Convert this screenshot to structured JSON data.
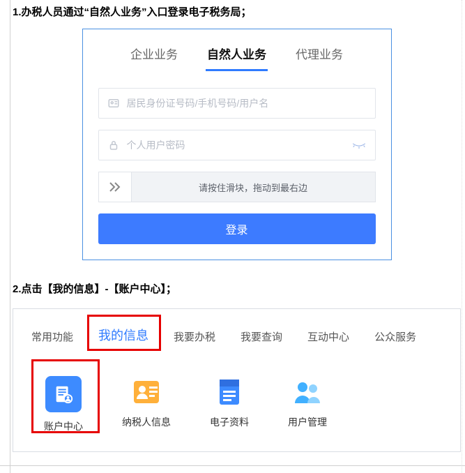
{
  "step1": "1.办税人员通过“自然人业务”入口登录电子税务局；",
  "login": {
    "tabs": [
      "企业业务",
      "自然人业务",
      "代理业务"
    ],
    "active_tab": 1,
    "id_placeholder": "居民身份证号码/手机号码/用户名",
    "pw_placeholder": "个人用户密码",
    "slider_text": "请按住滑块，拖动到最右边",
    "login_label": "登录"
  },
  "step2": "2.点击【我的信息】-【账户中心】；",
  "nav": {
    "tabs": [
      "常用功能",
      "我的信息",
      "我要办税",
      "我要查询",
      "互动中心",
      "公众服务"
    ],
    "highlight_tab": 1,
    "tiles": [
      {
        "label": "账户中心",
        "icon": "account-center-icon"
      },
      {
        "label": "纳税人信息",
        "icon": "taxpayer-info-icon"
      },
      {
        "label": "电子资料",
        "icon": "e-docs-icon"
      },
      {
        "label": "用户管理",
        "icon": "user-mgmt-icon"
      }
    ],
    "highlight_tile": 0
  }
}
